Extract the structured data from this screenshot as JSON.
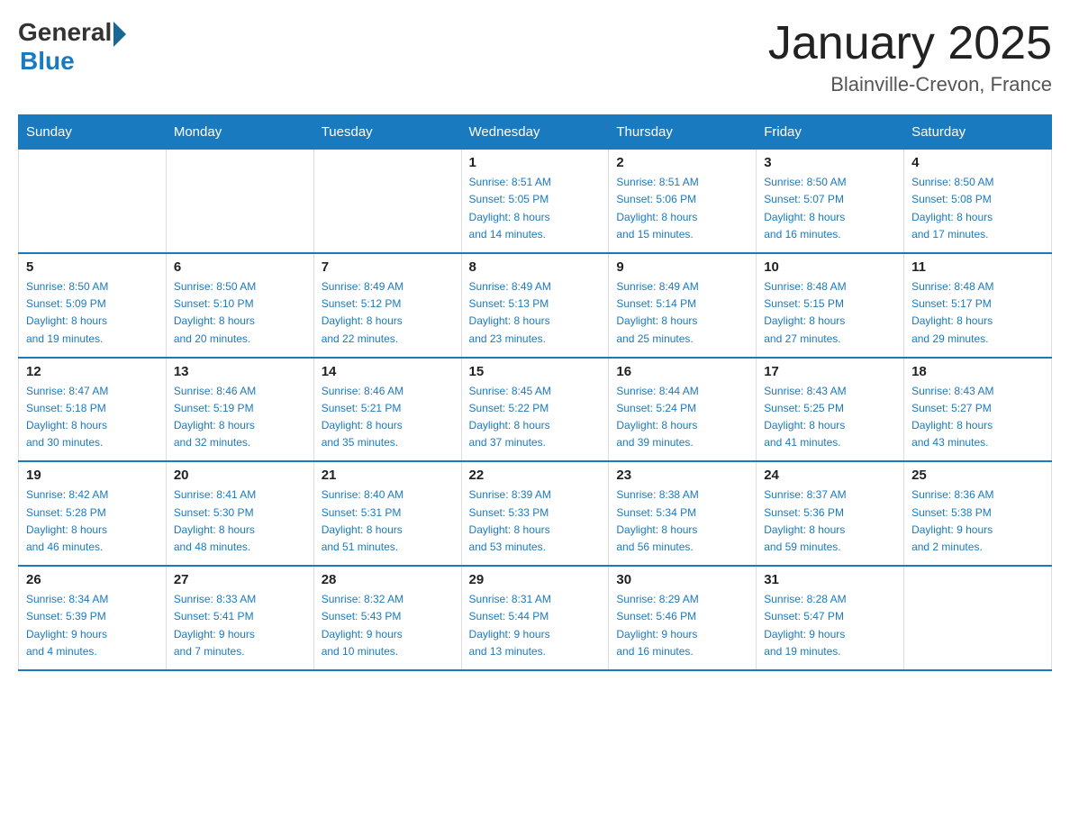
{
  "logo": {
    "general": "General",
    "blue": "Blue"
  },
  "title": "January 2025",
  "subtitle": "Blainville-Crevon, France",
  "days_of_week": [
    "Sunday",
    "Monday",
    "Tuesday",
    "Wednesday",
    "Thursday",
    "Friday",
    "Saturday"
  ],
  "weeks": [
    [
      {
        "day": "",
        "info": ""
      },
      {
        "day": "",
        "info": ""
      },
      {
        "day": "",
        "info": ""
      },
      {
        "day": "1",
        "info": "Sunrise: 8:51 AM\nSunset: 5:05 PM\nDaylight: 8 hours\nand 14 minutes."
      },
      {
        "day": "2",
        "info": "Sunrise: 8:51 AM\nSunset: 5:06 PM\nDaylight: 8 hours\nand 15 minutes."
      },
      {
        "day": "3",
        "info": "Sunrise: 8:50 AM\nSunset: 5:07 PM\nDaylight: 8 hours\nand 16 minutes."
      },
      {
        "day": "4",
        "info": "Sunrise: 8:50 AM\nSunset: 5:08 PM\nDaylight: 8 hours\nand 17 minutes."
      }
    ],
    [
      {
        "day": "5",
        "info": "Sunrise: 8:50 AM\nSunset: 5:09 PM\nDaylight: 8 hours\nand 19 minutes."
      },
      {
        "day": "6",
        "info": "Sunrise: 8:50 AM\nSunset: 5:10 PM\nDaylight: 8 hours\nand 20 minutes."
      },
      {
        "day": "7",
        "info": "Sunrise: 8:49 AM\nSunset: 5:12 PM\nDaylight: 8 hours\nand 22 minutes."
      },
      {
        "day": "8",
        "info": "Sunrise: 8:49 AM\nSunset: 5:13 PM\nDaylight: 8 hours\nand 23 minutes."
      },
      {
        "day": "9",
        "info": "Sunrise: 8:49 AM\nSunset: 5:14 PM\nDaylight: 8 hours\nand 25 minutes."
      },
      {
        "day": "10",
        "info": "Sunrise: 8:48 AM\nSunset: 5:15 PM\nDaylight: 8 hours\nand 27 minutes."
      },
      {
        "day": "11",
        "info": "Sunrise: 8:48 AM\nSunset: 5:17 PM\nDaylight: 8 hours\nand 29 minutes."
      }
    ],
    [
      {
        "day": "12",
        "info": "Sunrise: 8:47 AM\nSunset: 5:18 PM\nDaylight: 8 hours\nand 30 minutes."
      },
      {
        "day": "13",
        "info": "Sunrise: 8:46 AM\nSunset: 5:19 PM\nDaylight: 8 hours\nand 32 minutes."
      },
      {
        "day": "14",
        "info": "Sunrise: 8:46 AM\nSunset: 5:21 PM\nDaylight: 8 hours\nand 35 minutes."
      },
      {
        "day": "15",
        "info": "Sunrise: 8:45 AM\nSunset: 5:22 PM\nDaylight: 8 hours\nand 37 minutes."
      },
      {
        "day": "16",
        "info": "Sunrise: 8:44 AM\nSunset: 5:24 PM\nDaylight: 8 hours\nand 39 minutes."
      },
      {
        "day": "17",
        "info": "Sunrise: 8:43 AM\nSunset: 5:25 PM\nDaylight: 8 hours\nand 41 minutes."
      },
      {
        "day": "18",
        "info": "Sunrise: 8:43 AM\nSunset: 5:27 PM\nDaylight: 8 hours\nand 43 minutes."
      }
    ],
    [
      {
        "day": "19",
        "info": "Sunrise: 8:42 AM\nSunset: 5:28 PM\nDaylight: 8 hours\nand 46 minutes."
      },
      {
        "day": "20",
        "info": "Sunrise: 8:41 AM\nSunset: 5:30 PM\nDaylight: 8 hours\nand 48 minutes."
      },
      {
        "day": "21",
        "info": "Sunrise: 8:40 AM\nSunset: 5:31 PM\nDaylight: 8 hours\nand 51 minutes."
      },
      {
        "day": "22",
        "info": "Sunrise: 8:39 AM\nSunset: 5:33 PM\nDaylight: 8 hours\nand 53 minutes."
      },
      {
        "day": "23",
        "info": "Sunrise: 8:38 AM\nSunset: 5:34 PM\nDaylight: 8 hours\nand 56 minutes."
      },
      {
        "day": "24",
        "info": "Sunrise: 8:37 AM\nSunset: 5:36 PM\nDaylight: 8 hours\nand 59 minutes."
      },
      {
        "day": "25",
        "info": "Sunrise: 8:36 AM\nSunset: 5:38 PM\nDaylight: 9 hours\nand 2 minutes."
      }
    ],
    [
      {
        "day": "26",
        "info": "Sunrise: 8:34 AM\nSunset: 5:39 PM\nDaylight: 9 hours\nand 4 minutes."
      },
      {
        "day": "27",
        "info": "Sunrise: 8:33 AM\nSunset: 5:41 PM\nDaylight: 9 hours\nand 7 minutes."
      },
      {
        "day": "28",
        "info": "Sunrise: 8:32 AM\nSunset: 5:43 PM\nDaylight: 9 hours\nand 10 minutes."
      },
      {
        "day": "29",
        "info": "Sunrise: 8:31 AM\nSunset: 5:44 PM\nDaylight: 9 hours\nand 13 minutes."
      },
      {
        "day": "30",
        "info": "Sunrise: 8:29 AM\nSunset: 5:46 PM\nDaylight: 9 hours\nand 16 minutes."
      },
      {
        "day": "31",
        "info": "Sunrise: 8:28 AM\nSunset: 5:47 PM\nDaylight: 9 hours\nand 19 minutes."
      },
      {
        "day": "",
        "info": ""
      }
    ]
  ]
}
